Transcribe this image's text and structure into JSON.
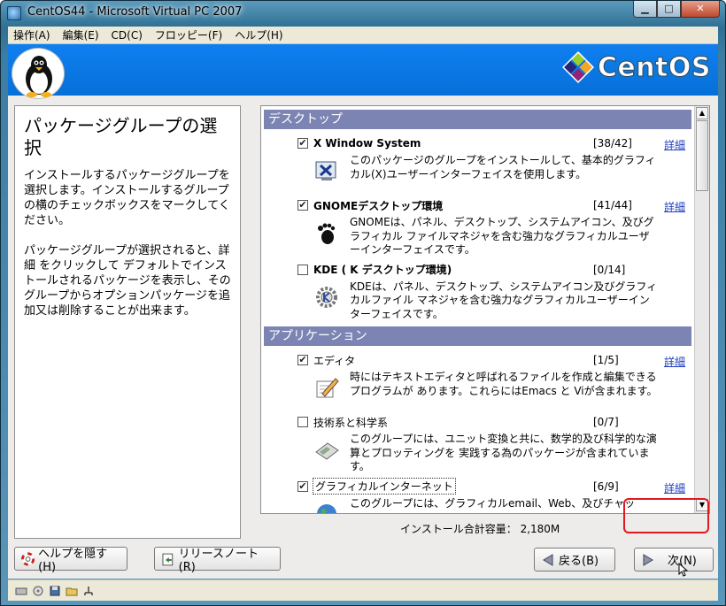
{
  "window": {
    "title": "CentOS44 - Microsoft Virtual PC 2007"
  },
  "menu": [
    "操作(A)",
    "編集(E)",
    "CD(C)",
    "フロッピー(F)",
    "ヘルプ(H)"
  ],
  "banner": {
    "logo_text": "CentOS"
  },
  "help": {
    "title": "パッケージグループの選択",
    "para1": "インストールするパッケージグループを選択します。インストールするグループの横のチェックボックスをマークしてください。",
    "para2": "パッケージグループが選択されると、詳細 をクリックして デフォルトでインストールされるパッケージを表示し、そのグループからオプションパッケージを追加又は削除することが出来ます。"
  },
  "categories": [
    {
      "name": "デスクトップ",
      "groups": [
        {
          "checked": true,
          "name": "X Window System",
          "count": "[38/42]",
          "link": "詳細",
          "icon": "x-window-icon",
          "desc": "このパッケージのグループをインストールして、基本的グラフィカル(X)ユーザーインターフェイスを使用します。"
        },
        {
          "checked": true,
          "name": "GNOMEデスクトップ環境",
          "count": "[41/44]",
          "link": "詳細",
          "icon": "gnome-foot-icon",
          "desc": "GNOMEは、パネル、デスクトップ、システムアイコン、及びグラフィカル ファイルマネジャを含む強力なグラフィカルユーザーインターフェイスです。"
        },
        {
          "checked": false,
          "name": "KDE ( K デスクトップ環境)",
          "count": "[0/14]",
          "link": "",
          "icon": "kde-gear-icon",
          "desc": "KDEは、パネル、デスクトップ、システムアイコン及びグラフィカルファイル マネジャを含む強力なグラフィカルユーザーインターフェイスです。"
        }
      ]
    },
    {
      "name": "アプリケーション",
      "groups": [
        {
          "checked": true,
          "name": "エディタ",
          "count": "[1/5]",
          "link": "詳細",
          "icon": "editor-pencil-icon",
          "desc": "時にはテキストエディタと呼ばれるファイルを作成と編集できるプログラムが あります。これらにはEmacs と Viが含まれます。"
        },
        {
          "checked": false,
          "name": "技術系と科学系",
          "count": "[0/7]",
          "link": "",
          "icon": "calculator-icon",
          "desc": "このグループには、ユニット変換と共に、数学的及び科学的な演算とプロッティングを 実践する為のパッケージが含まれています。"
        },
        {
          "checked": true,
          "name": "グラフィカルインターネット",
          "count": "[6/9]",
          "link": "詳細",
          "icon": "globe-icon",
          "desc": "このグループには、グラフィカルemail、Web、及びチャッ"
        }
      ]
    }
  ],
  "total_size": "インストール合計容量： 2,180M",
  "buttons": {
    "hide_help": "ヘルプを隠す(H)",
    "release_notes": "リリースノート(R)",
    "back": "戻る(B)",
    "next": "次(N)"
  },
  "colors": {
    "banner": "#0670d8",
    "category_header": "#7b84b3",
    "link": "#1f3fbf",
    "highlight": "#e0181f"
  }
}
